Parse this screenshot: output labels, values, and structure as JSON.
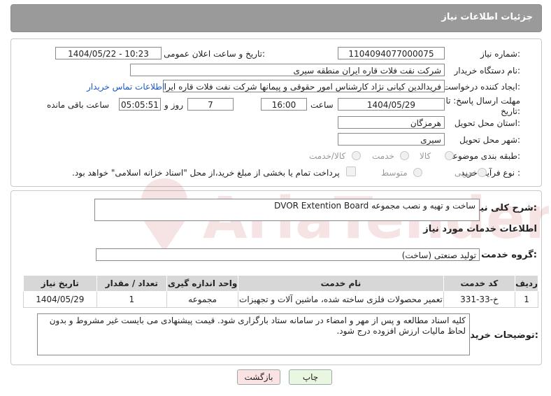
{
  "header": {
    "title": "جزئیات اطلاعات نیاز"
  },
  "need_number": {
    "label": "شماره نیاز:",
    "value": "1104094077000075"
  },
  "announce_datetime": {
    "label": "تاریخ و ساعت اعلان عمومی:",
    "value": "1404/05/22 - 10:23"
  },
  "buyer_org": {
    "label": "نام دستگاه خریدار:",
    "value": "شرکت نفت فلات قاره ایران منطقه سیری"
  },
  "requester": {
    "label": "ایجاد کننده درخواست:",
    "value": "فریدالدین کیانی نژاد کارشناس امور حقوقی و پیمانها شرکت نفت فلات قاره ایران",
    "contact_link": "اطلاعات تماس خریدار"
  },
  "deadline": {
    "label_line1": "مهلت ارسال پاسخ: تا",
    "label_line2": "تاریخ:",
    "date": "1404/05/29",
    "time_label": "ساعت",
    "time": "16:00",
    "days": "7",
    "days_label": "روز و",
    "remaining": "05:05:51",
    "remaining_label": "ساعت باقی مانده"
  },
  "province": {
    "label": "استان محل تحویل:",
    "value": "هرمزگان"
  },
  "city": {
    "label": "شهر محل تحویل:",
    "value": "سیری"
  },
  "category": {
    "label": "طبقه بندی موضوعی:",
    "options": [
      "کالا",
      "خدمت",
      "کالا/خدمت"
    ],
    "selected": null
  },
  "purchase_type": {
    "label": "نوع فرآیند خرید :",
    "options": [
      "جزیی",
      "متوسط"
    ],
    "note": "پرداخت تمام یا بخشی از مبلغ خرید،از محل \"اسناد خزانه اسلامی\" خواهد بود."
  },
  "description": {
    "label": "شرح کلی نیاز:",
    "value": "ساخت و تهیه و نصب مجموعه DVOR Extention Board"
  },
  "services_title": "اطلاعات خدمات مورد نیاز",
  "service_group": {
    "label": "گروه خدمت:",
    "value": "تولید صنعتی (ساخت)"
  },
  "table": {
    "headers": [
      "ردیف",
      "کد خدمت",
      "نام خدمت",
      "واحد اندازه گیری",
      "تعداد / مقدار",
      "تاریخ نیاز"
    ],
    "rows": [
      [
        "1",
        "خ-33-331",
        "تعمیر محصولات فلزی ساخته شده، ماشین آلات و تجهیزات",
        "مجموعه",
        "1",
        "1404/05/29"
      ]
    ]
  },
  "buyer_notes": {
    "label": "توضیحات خریدار:",
    "value": "کلیه اسناد مطالعه و پس از مهر و امضاء در سامانه ستاد بارگزاری شود. قیمت پیشنهادی می بایست غیر مشروط و بدون لحاظ مالیات ارزش افزوده درج شود."
  },
  "buttons": {
    "print": "چاپ",
    "back": "بازگشت"
  },
  "colors": {
    "header_bg": "#9a9a9a",
    "print_bg": "#eaf7e0",
    "back_bg": "#fbe3e3",
    "link": "#1a57c5"
  }
}
